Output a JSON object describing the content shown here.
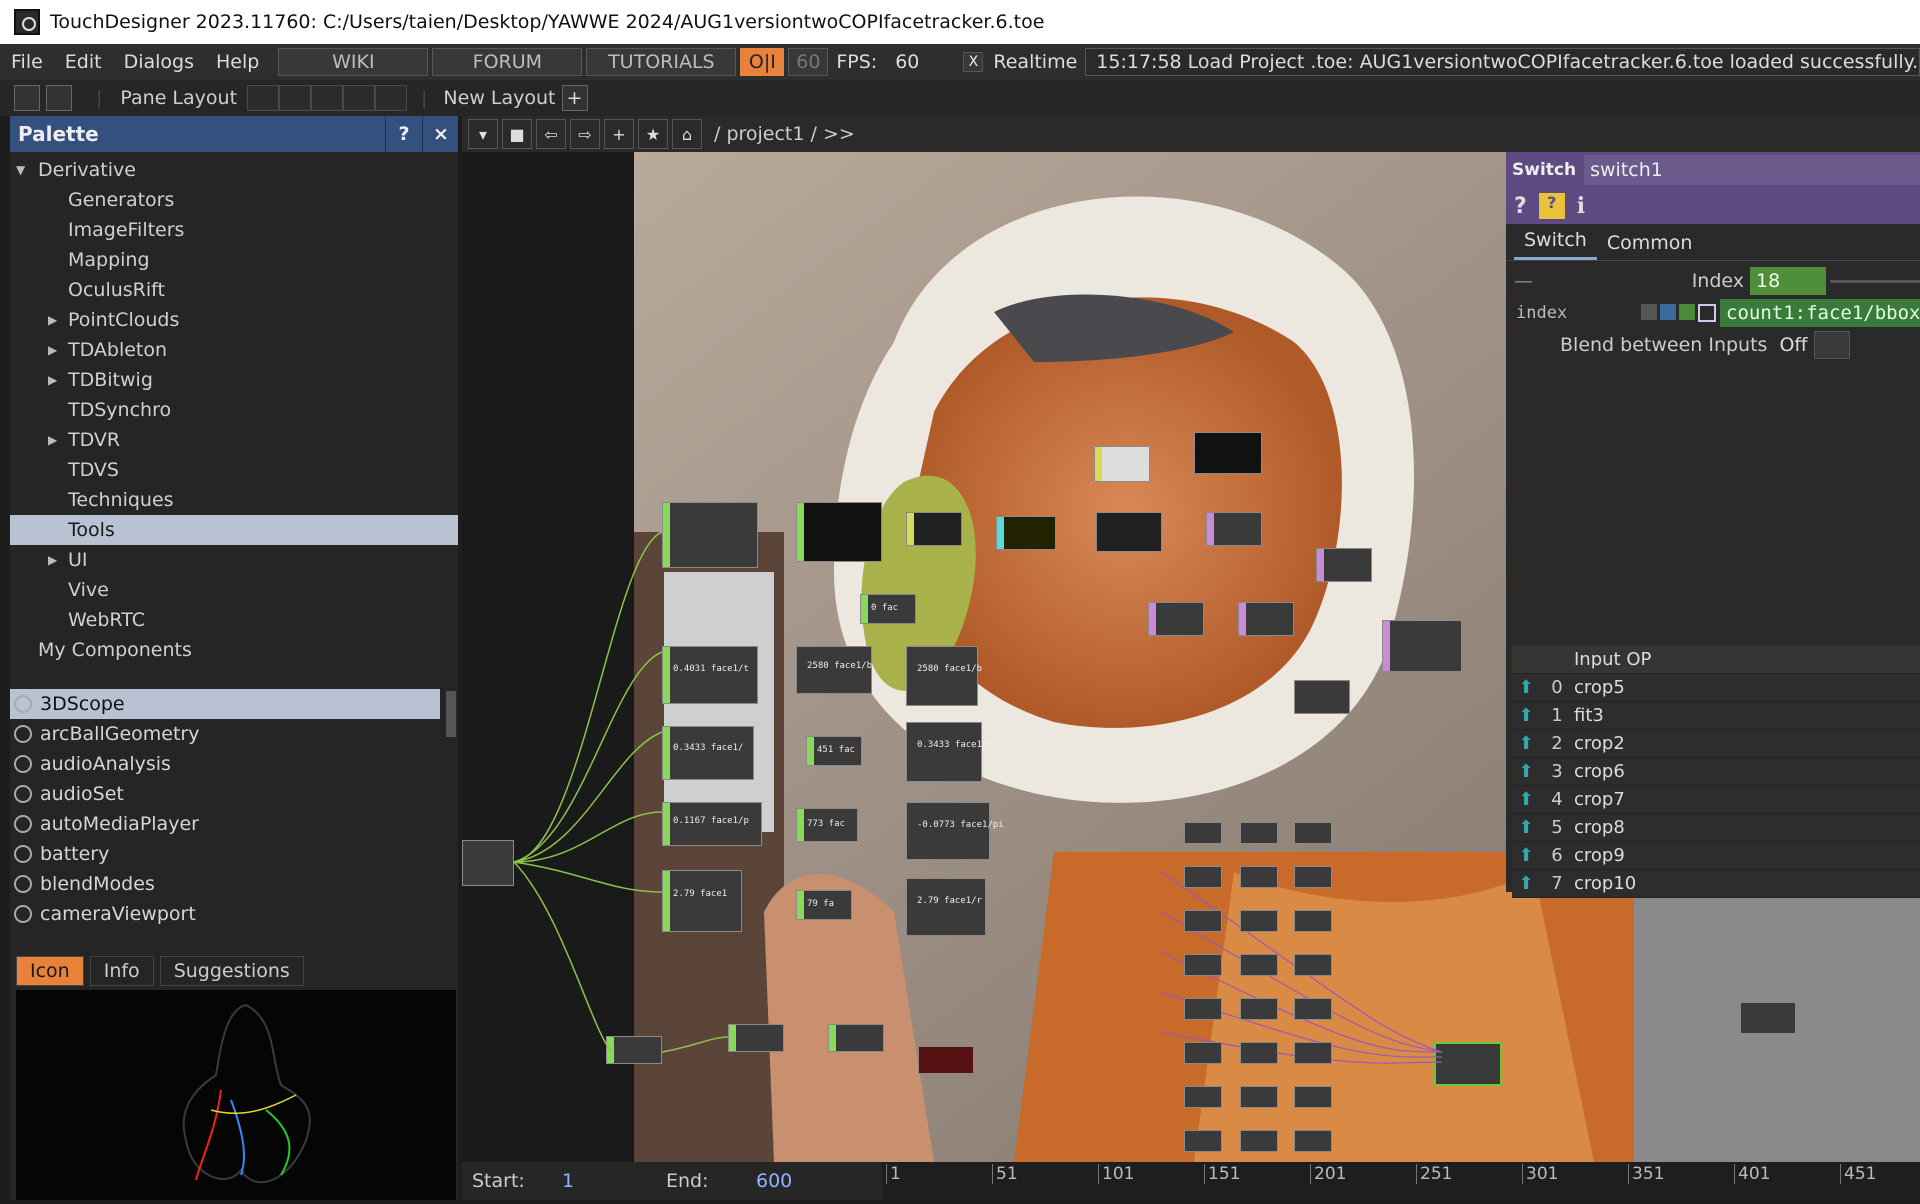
{
  "window": {
    "title": "TouchDesigner 2023.11760: C:/Users/taien/Desktop/YAWWE 2024/AUG1versiontwoCOPIfacetracker.6.toe"
  },
  "menubar": {
    "items": [
      "File",
      "Edit",
      "Dialogs",
      "Help"
    ],
    "wiki": "WIKI",
    "forum": "FORUM",
    "tutorials": "TUTORIALS",
    "oi": "O|I",
    "fps_target": "60",
    "fps_label": "FPS:",
    "fps_value": "60",
    "realtime_check": "X",
    "realtime_label": "Realtime",
    "status": "15:17:58 Load Project .toe: AUG1versiontwoCOPIfacetracker.6.toe loaded successfully."
  },
  "layoutbar": {
    "pane_layout": "Pane Layout",
    "new_layout": "New Layout",
    "add": "+"
  },
  "palette": {
    "title": "Palette",
    "help": "?",
    "close": "×",
    "tree": [
      {
        "label": "Derivative",
        "level": 0,
        "expander": "open"
      },
      {
        "label": "Generators",
        "level": 1,
        "expander": "none"
      },
      {
        "label": "ImageFilters",
        "level": 1,
        "expander": "none"
      },
      {
        "label": "Mapping",
        "level": 1,
        "expander": "none"
      },
      {
        "label": "OculusRift",
        "level": 1,
        "expander": "none"
      },
      {
        "label": "PointClouds",
        "level": 1,
        "expander": "closed"
      },
      {
        "label": "TDAbleton",
        "level": 1,
        "expander": "closed"
      },
      {
        "label": "TDBitwig",
        "level": 1,
        "expander": "closed"
      },
      {
        "label": "TDSynchro",
        "level": 1,
        "expander": "none"
      },
      {
        "label": "TDVR",
        "level": 1,
        "expander": "closed"
      },
      {
        "label": "TDVS",
        "level": 1,
        "expander": "none"
      },
      {
        "label": "Techniques",
        "level": 1,
        "expander": "none"
      },
      {
        "label": "Tools",
        "level": 1,
        "expander": "none",
        "selected": true
      },
      {
        "label": "UI",
        "level": 1,
        "expander": "closed"
      },
      {
        "label": "Vive",
        "level": 1,
        "expander": "none"
      },
      {
        "label": "WebRTC",
        "level": 1,
        "expander": "none"
      },
      {
        "label": "My Components",
        "level": 0,
        "expander": "none"
      }
    ],
    "components": [
      "3DScope",
      "arcBallGeometry",
      "audioAnalysis",
      "audioSet",
      "autoMediaPlayer",
      "battery",
      "blendModes",
      "cameraViewport"
    ],
    "tabs": [
      "Icon",
      "Info",
      "Suggestions"
    ]
  },
  "network": {
    "path": "/ project1 / >>"
  },
  "params": {
    "op_type": "Switch",
    "op_name": "switch1",
    "tabs": [
      "Switch",
      "Common"
    ],
    "index_label": "Index",
    "index_value": "18",
    "index_expr_label": "index",
    "index_expr": "count1:face1/bbox",
    "blend_label": "Blend between Inputs",
    "blend_value": "Off",
    "input_header": "Input OP",
    "inputs": [
      {
        "n": "0",
        "name": "crop5"
      },
      {
        "n": "1",
        "name": "fit3"
      },
      {
        "n": "2",
        "name": "crop2"
      },
      {
        "n": "3",
        "name": "crop6"
      },
      {
        "n": "4",
        "name": "crop7"
      },
      {
        "n": "5",
        "name": "crop8"
      },
      {
        "n": "6",
        "name": "crop9"
      },
      {
        "n": "7",
        "name": "crop10"
      }
    ]
  },
  "nodes": {
    "n1": "0.4031 face1/t",
    "n2": "2580 face1/b",
    "n3": "2580 face1/b",
    "n4": "0.3433 face1/",
    "n5": "451 fac",
    "n6": "0.3433 face1/p",
    "n7": "0.1167 face1/p",
    "n8": "773 fac",
    "n9": "-0.0773 face1/pi",
    "n10": "2.79 face1",
    "n11": "79 fa",
    "n12": "2.79 face1/r",
    "n13": "0 fac"
  },
  "timeline": {
    "start_label": "Start:",
    "start_value": "1",
    "end_label": "End:",
    "end_value": "600",
    "ticks": [
      "1",
      "51",
      "101",
      "151",
      "201",
      "251",
      "301",
      "351",
      "401",
      "451"
    ]
  },
  "colors": {
    "accent_orange": "#e8823a",
    "palette_header": "#34507e",
    "param_header": "#5c4a80",
    "expr_green": "#3e7e3e"
  }
}
